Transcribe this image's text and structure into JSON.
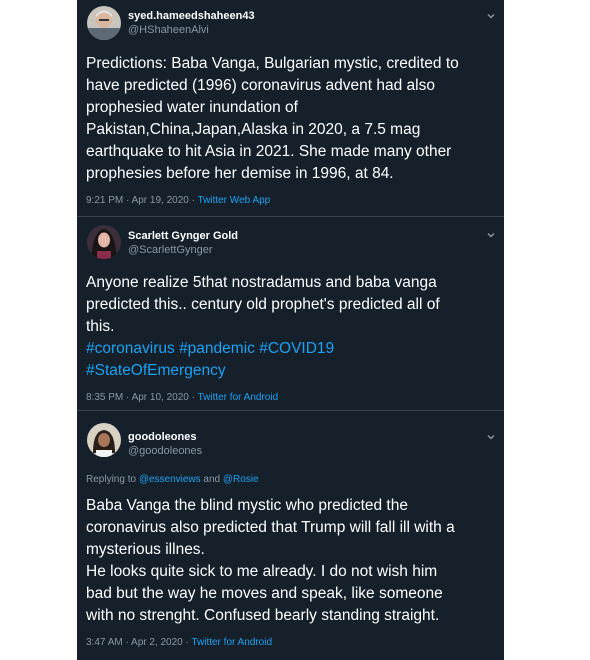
{
  "tweets": [
    {
      "name": "syed.hameedshaheen43",
      "handle": "@HShaheenAlvi",
      "lines": [
        "Predictions: Baba Vanga, Bulgarian mystic, credited to",
        "have predicted (1996) coronavirus advent had also",
        "prophesied water inundation of",
        "Pakistan,China,Japan,Alaska in 2020, a 7.5 mag",
        "earthquake to hit Asia in 2021. She made many other",
        "prophesies before her demise in 1996, at 84."
      ],
      "time": "9:21 PM · Apr 19, 2020 · ",
      "source": "Twitter Web App"
    },
    {
      "name": "Scarlett Gynger Gold",
      "handle": "@ScarlettGynger",
      "lines": [
        "Anyone realize 5that nostradamus and baba vanga",
        "predicted this.. century old prophet's predicted all of",
        "this."
      ],
      "hashtags": [
        "#coronavirus",
        "#pandemic",
        "#COVID19",
        "#StateOfEmergency"
      ],
      "time": "8:35 PM · Apr 10, 2020 · ",
      "source": "Twitter for Android"
    },
    {
      "name": "goodoleones",
      "handle": "@goodoleones",
      "replying_prefix": "Replying to ",
      "replying_user1": "@essenviews",
      "replying_and": " and ",
      "replying_user2": "@Rosie",
      "lines": [
        "Baba Vanga the blind mystic who predicted the",
        "coronavirus also predicted that Trump will fall ill with a",
        "mysterious illnes.",
        "He looks quite sick to me already. I do not wish him",
        "bad but the way he moves and speak, like someone",
        "with no strenght. Confused bearly standing straight."
      ],
      "time": "3:47 AM · Apr 2, 2020 · ",
      "source": "Twitter for Android"
    }
  ],
  "colors": {
    "background": "#15202b",
    "divider": "#38444d",
    "secondary_text": "#8899a6",
    "link": "#1da1f2"
  },
  "icons": [
    "avatar-syed",
    "avatar-scarlett",
    "avatar-goodoleones",
    "chevron-down-icon"
  ]
}
